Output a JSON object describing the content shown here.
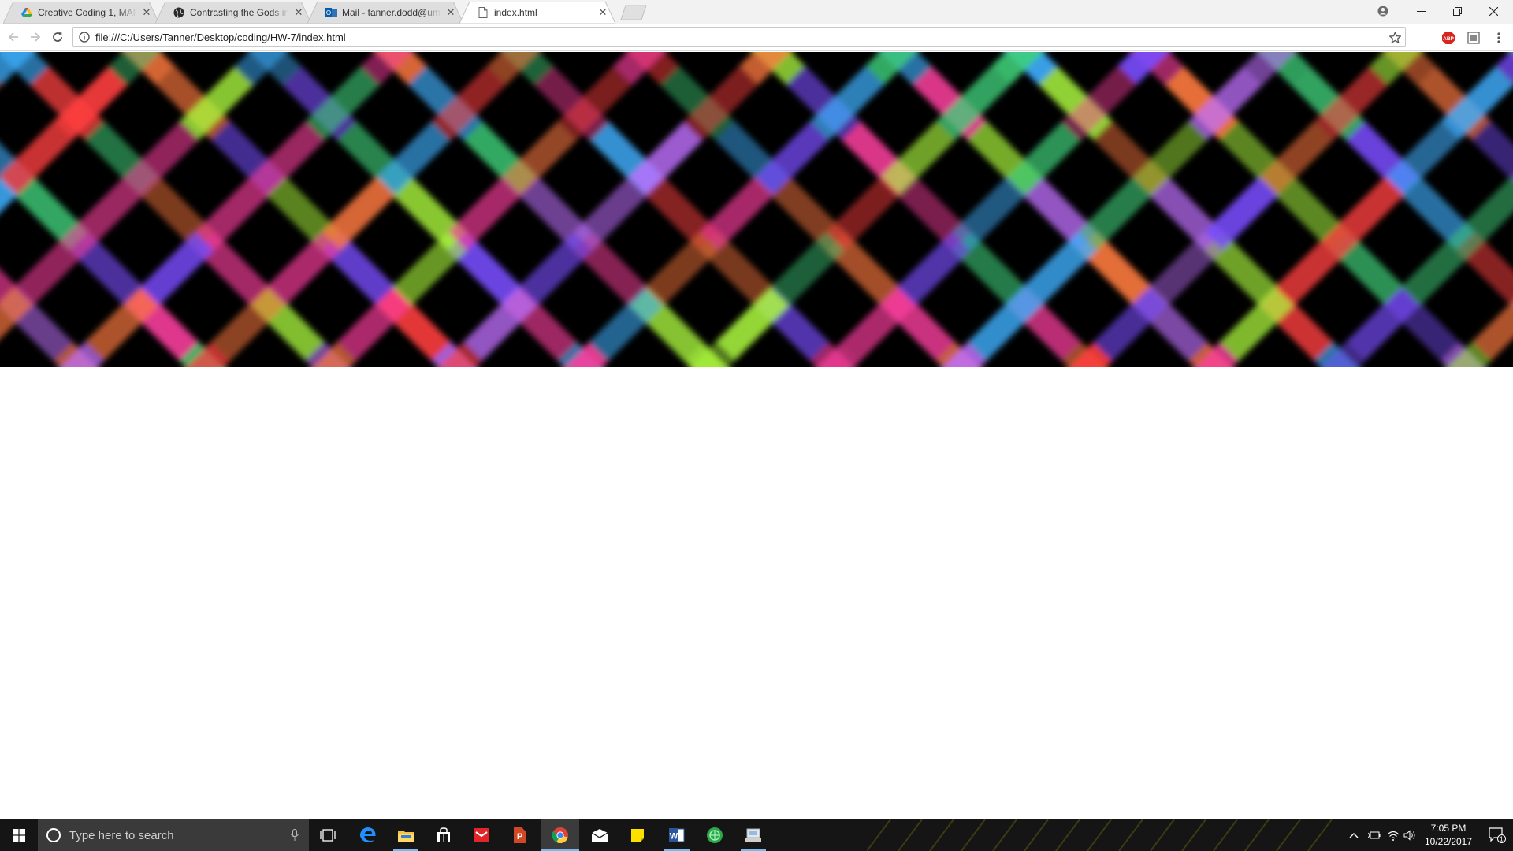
{
  "browser": {
    "tabs": [
      {
        "title": "Creative Coding 1, MART",
        "favicon": "google-drive-icon",
        "active": false
      },
      {
        "title": "Contrasting the Gods in t",
        "favicon": "globe-icon",
        "active": false
      },
      {
        "title": "Mail - tanner.dodd@um",
        "favicon": "outlook-icon",
        "active": false
      },
      {
        "title": "index.html",
        "favicon": "page-icon",
        "active": true
      }
    ],
    "url": "file:///C:/Users/Tanner/Desktop/coding/HW-7/index.html",
    "extensions": [
      "adblock-plus-icon",
      "extension-icon"
    ]
  },
  "page": {
    "sketch": {
      "description_colors": [
        "#ff3fa0",
        "#3fd07a",
        "#7a4dff",
        "#ff7a3f",
        "#3fb0ff",
        "#b0ff3f",
        "#ff3f3f",
        "#c070ff"
      ],
      "background": "#000000"
    }
  },
  "taskbar": {
    "search_placeholder": "Type here to search",
    "apps": [
      "task-view-icon",
      "edge-icon",
      "file-explorer-icon",
      "store-icon",
      "mail-red-icon",
      "powerpoint-icon",
      "chrome-icon",
      "mail-icon",
      "sticky-notes-icon",
      "word-icon",
      "app-green-icon",
      "network-app-icon"
    ],
    "time": "7:05 PM",
    "date": "10/22/2017",
    "notification_count": "1"
  }
}
